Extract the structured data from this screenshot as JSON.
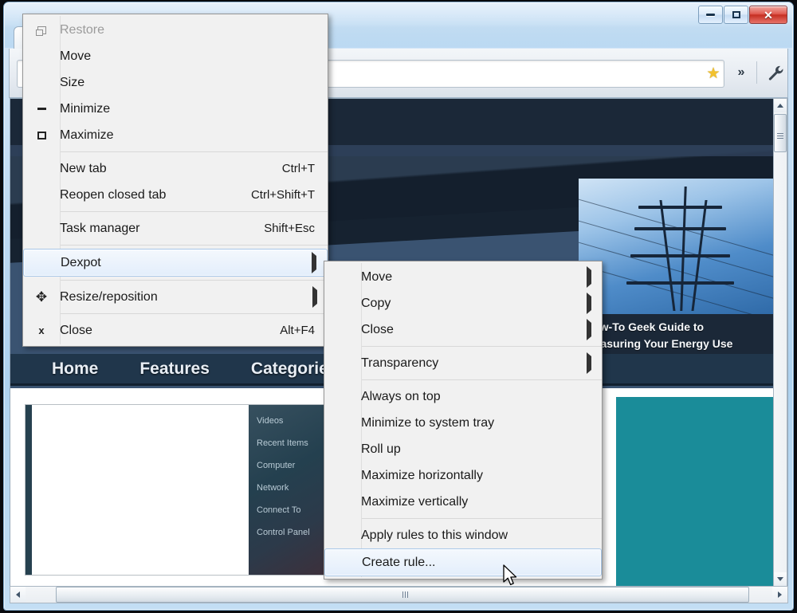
{
  "window": {
    "caption_buttons": [
      {
        "name": "minimize",
        "glyph": "minimize-icon"
      },
      {
        "name": "maximize",
        "glyph": "maximize-icon"
      },
      {
        "name": "close",
        "glyph": "close-icon",
        "label": "✕"
      }
    ]
  },
  "browser": {
    "omnibox": {
      "value": "",
      "placeholder": ""
    },
    "star_icon": "★",
    "chevron_label": "»",
    "wrench_icon": "wrench-icon"
  },
  "window_menu": {
    "items": [
      {
        "id": "restore",
        "label": "Restore",
        "accel": "",
        "icon": "restore-icon",
        "disabled": true,
        "submenu": false,
        "selected": false
      },
      {
        "id": "move",
        "label": "Move",
        "accel": "",
        "icon": "",
        "disabled": false,
        "submenu": false,
        "selected": false
      },
      {
        "id": "size",
        "label": "Size",
        "accel": "",
        "icon": "",
        "disabled": false,
        "submenu": false,
        "selected": false
      },
      {
        "id": "minimize",
        "label": "Minimize",
        "accel": "",
        "icon": "minimize-icon",
        "disabled": false,
        "submenu": false,
        "selected": false
      },
      {
        "id": "maximize",
        "label": "Maximize",
        "accel": "",
        "icon": "maximize-icon",
        "disabled": false,
        "submenu": false,
        "selected": false
      },
      {
        "id": "sep1",
        "separator": true
      },
      {
        "id": "new-tab",
        "label": "New tab",
        "accel": "Ctrl+T",
        "icon": "",
        "disabled": false,
        "submenu": false,
        "selected": false
      },
      {
        "id": "reopen-tab",
        "label": "Reopen closed tab",
        "accel": "Ctrl+Shift+T",
        "icon": "",
        "disabled": false,
        "submenu": false,
        "selected": false
      },
      {
        "id": "sep2",
        "separator": true
      },
      {
        "id": "task-manager",
        "label": "Task manager",
        "accel": "Shift+Esc",
        "icon": "",
        "disabled": false,
        "submenu": false,
        "selected": false
      },
      {
        "id": "sep3",
        "separator": true
      },
      {
        "id": "dexpot",
        "label": "Dexpot",
        "accel": "",
        "icon": "",
        "disabled": false,
        "submenu": true,
        "selected": true
      },
      {
        "id": "sep4",
        "separator": true
      },
      {
        "id": "resize-reposition",
        "label": "Resize/reposition",
        "accel": "",
        "icon": "move-icon",
        "disabled": false,
        "submenu": true,
        "selected": false
      },
      {
        "id": "sep5",
        "separator": true
      },
      {
        "id": "close",
        "label": "Close",
        "accel": "Alt+F4",
        "icon": "close-x-icon",
        "disabled": false,
        "submenu": false,
        "selected": false
      }
    ]
  },
  "dexpot_menu": {
    "items": [
      {
        "id": "move",
        "label": "Move",
        "submenu": true,
        "selected": false
      },
      {
        "id": "copy",
        "label": "Copy",
        "submenu": true,
        "selected": false
      },
      {
        "id": "close",
        "label": "Close",
        "submenu": true,
        "selected": false
      },
      {
        "id": "sep1",
        "separator": true
      },
      {
        "id": "transparency",
        "label": "Transparency",
        "submenu": true,
        "selected": false
      },
      {
        "id": "sep2",
        "separator": true
      },
      {
        "id": "always-on-top",
        "label": "Always on top",
        "submenu": false,
        "selected": false
      },
      {
        "id": "min-tray",
        "label": "Minimize to system tray",
        "submenu": false,
        "selected": false
      },
      {
        "id": "roll-up",
        "label": "Roll up",
        "submenu": false,
        "selected": false
      },
      {
        "id": "max-horiz",
        "label": "Maximize horizontally",
        "submenu": false,
        "selected": false
      },
      {
        "id": "max-vert",
        "label": "Maximize vertically",
        "submenu": false,
        "selected": false
      },
      {
        "id": "sep3",
        "separator": true
      },
      {
        "id": "apply-rules",
        "label": "Apply rules to this window",
        "submenu": false,
        "selected": false
      },
      {
        "id": "create-rule",
        "label": "Create rule...",
        "submenu": false,
        "selected": true
      }
    ]
  },
  "page": {
    "nav": [
      {
        "id": "home",
        "label": "Home",
        "caret": false
      },
      {
        "id": "features",
        "label": "Features",
        "caret": false
      },
      {
        "id": "categories",
        "label": "Categories",
        "caret": true,
        "caret_glyph": "▼"
      }
    ],
    "feature_card": {
      "caption_line1": "How-To Geek Guide to",
      "caption_line2": "Measuring Your Energy Use"
    },
    "start_menu_shot": {
      "items": [
        "Videos",
        "Recent Items",
        "Computer",
        "Network",
        "Connect To",
        "Control Panel"
      ]
    }
  },
  "colors": {
    "teal_block": "#1a8c99",
    "site_dark": "#1b2838",
    "nav_bar": "#20364b",
    "menu_bg": "#f1f1f1",
    "menu_selected": "#e3eefb",
    "close_btn": "#c52f22",
    "aero_title": "#b6d6f1"
  },
  "scrollbars": {
    "vertical": {
      "up": "▲",
      "down": "▼"
    },
    "horizontal": {
      "left": "◀",
      "right": "▶"
    }
  }
}
